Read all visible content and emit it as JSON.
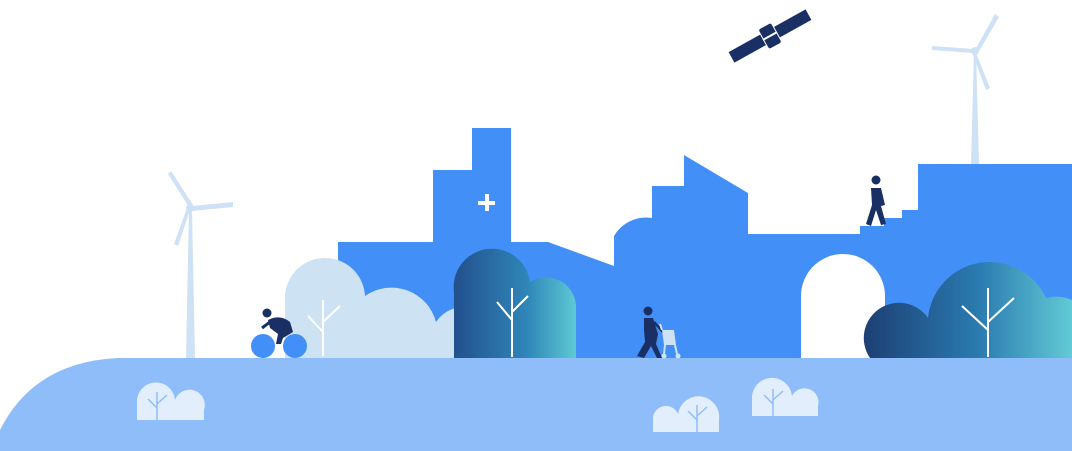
{
  "illustration": {
    "colors": {
      "background": "#ffffff",
      "ground": "#8fbdf9",
      "building": "#438ff8",
      "navy": "#1a2f63",
      "turbine": "#cfe1f4",
      "pale_tree": "#cde2f3",
      "ground_shrub": "#e2eefb",
      "teal_dark": "#214f88",
      "teal_light": "#5fc7d4"
    },
    "icons": [
      "satellite-icon",
      "medical-cross-icon",
      "wind-turbine-icon",
      "cyclist-icon",
      "pedestrian-with-stroller-icon",
      "walking-person-icon",
      "tree-icon",
      "shrub-icon"
    ]
  }
}
